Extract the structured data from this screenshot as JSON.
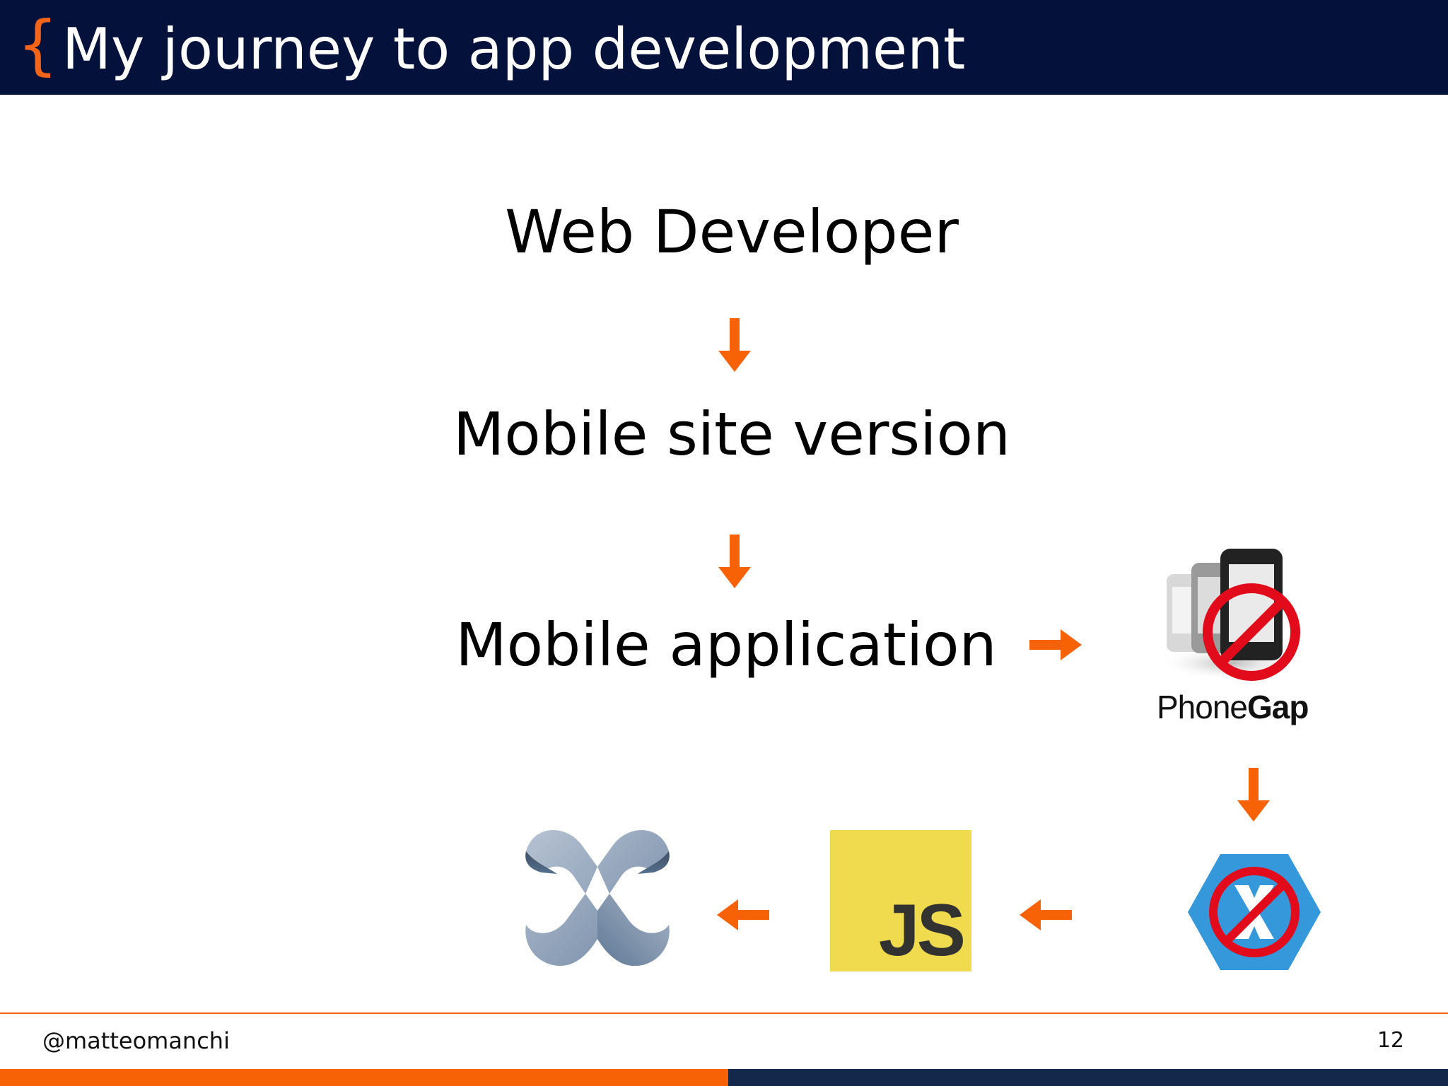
{
  "header": {
    "brace": "{",
    "title": "My journey to app development",
    "background": "#03113b",
    "accent": "#f4651a"
  },
  "steps": [
    "Web Developer",
    "Mobile site version",
    "Mobile application"
  ],
  "logos": {
    "phonegap": {
      "word_plain": "Phone",
      "word_bold": "Gap",
      "status": "crossed-out"
    },
    "xamarin": {
      "status": "crossed-out"
    },
    "javascript": {
      "label": "JS",
      "color": "#f0db4f"
    },
    "nativescript": {
      "icon": "nativescript-logo-icon"
    }
  },
  "footer": {
    "handle": "@matteomanchi",
    "page_number": "12",
    "bar_left_color": "#f76207",
    "bar_right_color": "#13284a"
  }
}
